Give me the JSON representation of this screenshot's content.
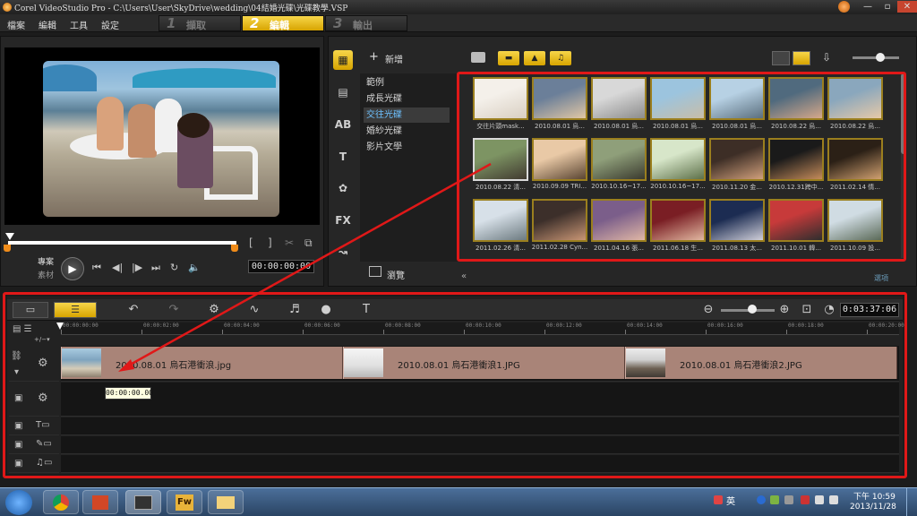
{
  "window": {
    "title": "Corel VideoStudio Pro - C:\\Users\\User\\SkyDrive\\wedding\\04結婚光碟\\光碟教學.VSP"
  },
  "menu": [
    "檔案",
    "編輯",
    "工具",
    "設定"
  ],
  "steps": [
    {
      "num": "1",
      "label": "擷取",
      "active": false
    },
    {
      "num": "2",
      "label": "編輯",
      "active": true
    },
    {
      "num": "3",
      "label": "輸出",
      "active": false
    }
  ],
  "preview": {
    "mode_project": "專案",
    "mode_clip": "素材",
    "timecode": "00:00:00:00"
  },
  "library": {
    "add_label": "新增",
    "categories": [
      "範例",
      "成長光碟",
      "交往光碟",
      "婚紗光碟",
      "影片文學"
    ],
    "selected_category": "交往光碟",
    "browse_label": "瀏覽",
    "options_label": "選項",
    "thumbs": [
      "交往片頭mask...",
      "2010.08.01 烏...",
      "2010.08.01 烏...",
      "2010.08.01 烏...",
      "2010.08.01 烏...",
      "2010.08.22 烏...",
      "2010.08.22 烏...",
      "2010.08.22 清...",
      "2010.09.09 TRI...",
      "2010.10.16~17...",
      "2010.10.16~17...",
      "2010.11.20 金...",
      "2010.12.31跨中...",
      "2011.02.14 情...",
      "2011.02.26 清...",
      "2011.02.28 Cyn...",
      "2011.04.16 張...",
      "2011.06.18 生...",
      "2011.08.13 太...",
      "2011.10.01 韓...",
      "2011.10.09 設..."
    ]
  },
  "timeline": {
    "duration": "0:03:37:06",
    "ruler": [
      "00:00:00:00",
      "00:00:02:00",
      "00:00:04:00",
      "00:00:06:00",
      "00:00:08:00",
      "00:00:10:00",
      "00:00:12:00",
      "00:00:14:00",
      "00:00:16:00",
      "00:00:18:00",
      "00:00:20:00"
    ],
    "clips": [
      {
        "name": "2010.08.01 烏石港衝浪.jpg"
      },
      {
        "name": "2010.08.01 烏石港衝浪1.JPG"
      },
      {
        "name": "2010.08.01 烏石港衝浪2.JPG"
      }
    ],
    "tooltip": "00:00:00.00"
  },
  "taskbar": {
    "apps": [
      "chrome",
      "powerpoint",
      "videostudio",
      "fireworks",
      "explorer"
    ],
    "app_labels": [
      "",
      "",
      "",
      "Fw",
      ""
    ],
    "lang": "英",
    "time": "下午 10:59",
    "date": "2013/11/28"
  },
  "colors": {
    "accent": "#f7d64a",
    "highlight": "#e01818",
    "clip": "#a98478"
  }
}
